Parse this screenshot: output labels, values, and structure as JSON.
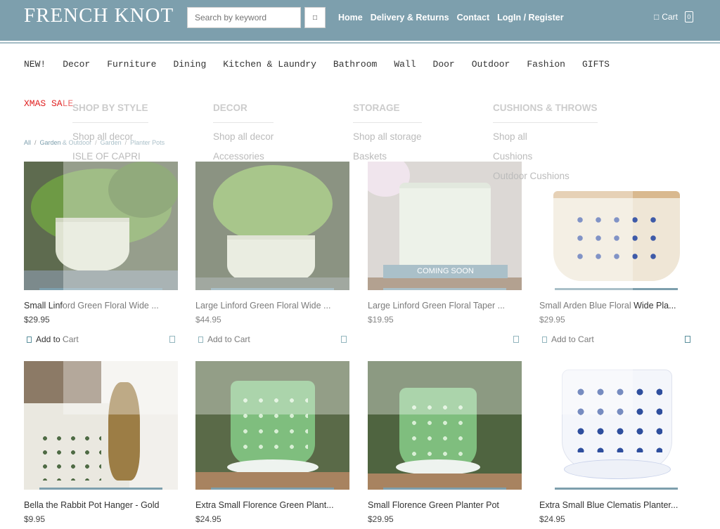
{
  "header": {
    "logo": "FRENCH KNOT",
    "search_placeholder": "Search by keyword",
    "links": [
      "Home",
      "Delivery & Returns",
      "Contact",
      "LogIn / Register"
    ],
    "cart_label": "Cart",
    "cart_count": "0"
  },
  "nav": {
    "items": [
      "NEW!",
      "Decor",
      "Furniture",
      "Dining",
      "Kitchen & Laundry",
      "Bathroom",
      "Wall",
      "Door",
      "Outdoor",
      "Fashion",
      "GIFTS"
    ],
    "sale": "XMAS SALE"
  },
  "mega_menu": {
    "columns": [
      {
        "head": "SHOP BY STYLE",
        "items": [
          "Shop all decor",
          "ISLE OF CAPRI"
        ]
      },
      {
        "head": "DECOR",
        "items": [
          "Shop all decor",
          "Accessories"
        ]
      },
      {
        "head": "STORAGE",
        "items": [
          "Shop all storage",
          "Baskets"
        ]
      },
      {
        "head": "CUSHIONS & THROWS",
        "items": [
          "Shop all",
          "Cushions",
          "Outdoor Cushions"
        ]
      }
    ]
  },
  "breadcrumb": [
    "All",
    "Garden & Outdoor",
    "Garden",
    "Planter Pots"
  ],
  "products": [
    {
      "name": "Small Linford Green Floral Wide ...",
      "price": "$29.95",
      "add": "Add to Cart",
      "soon": ""
    },
    {
      "name": "Large Linford Green Floral Wide ...",
      "price": "$44.95",
      "add": "Add to Cart",
      "soon": ""
    },
    {
      "name": "Large Linford Green Floral Taper ...",
      "price": "$19.95",
      "add": "",
      "soon": "COMING SOON"
    },
    {
      "name": "Small Arden Blue Floral Wide Pla...",
      "price": "$29.95",
      "add": "Add to Cart",
      "soon": ""
    },
    {
      "name": "Bella the Rabbit Pot Hanger - Gold",
      "price": "$9.95",
      "add": "",
      "soon": ""
    },
    {
      "name": "Extra Small Florence Green Plant...",
      "price": "$24.95",
      "add": "",
      "soon": ""
    },
    {
      "name": "Small Florence Green Planter Pot",
      "price": "$29.95",
      "add": "",
      "soon": ""
    },
    {
      "name": "Extra Small Blue Clematis Planter...",
      "price": "$24.95",
      "add": "",
      "soon": ""
    }
  ],
  "colors": {
    "header": "#7d9fad",
    "sale": "#e02020"
  }
}
